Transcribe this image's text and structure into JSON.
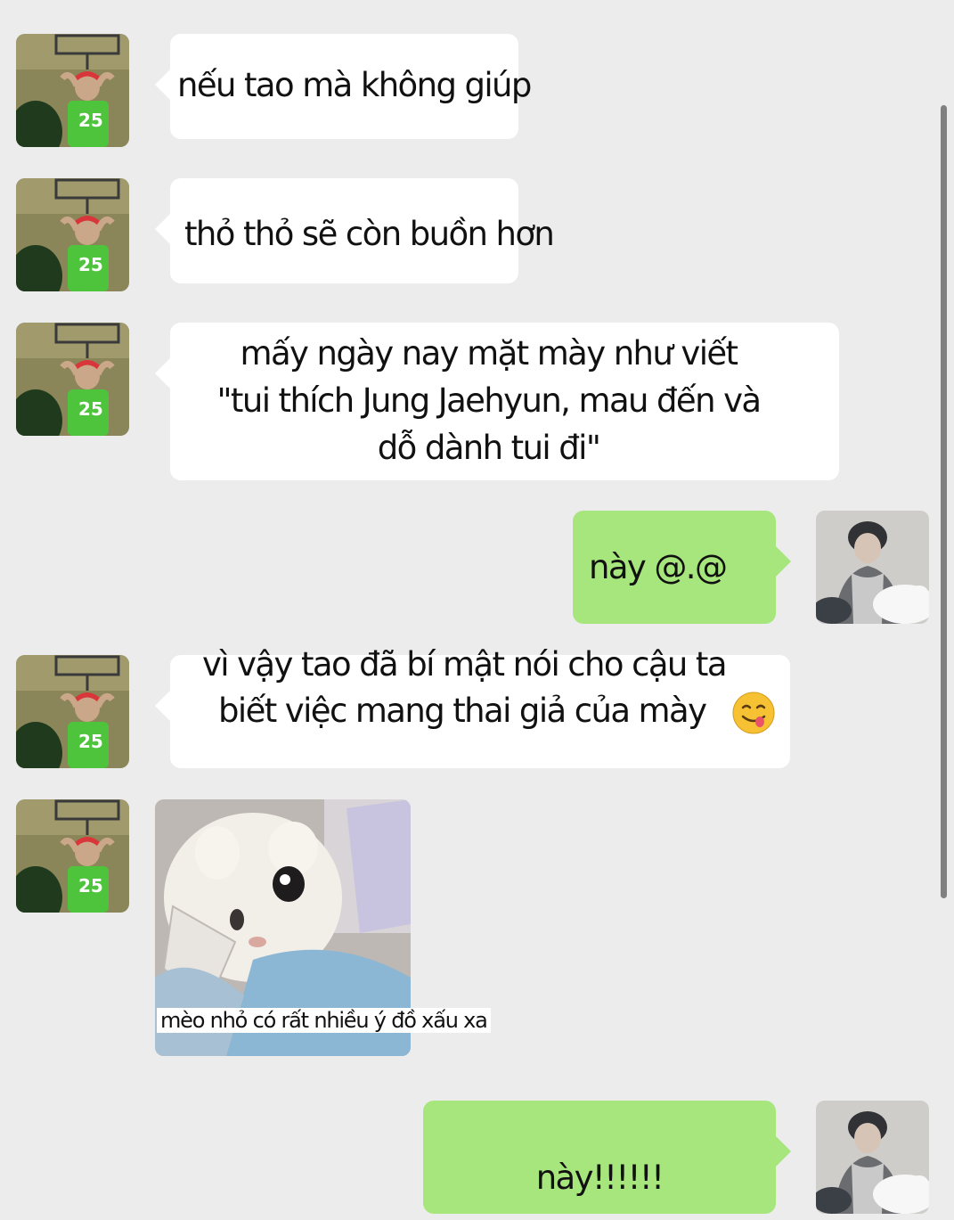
{
  "messages": [
    {
      "lines": [
        "nếu tao mà không giúp"
      ]
    },
    {
      "lines": [
        "thỏ thỏ sẽ còn buồn hơn"
      ]
    },
    {
      "lines": [
        "mấy ngày nay mặt mày như viết",
        "\"tui thích Jung Jaehyun, mau đến và",
        "dỗ dành tui đi\""
      ]
    },
    {
      "lines": [
        "này @.@"
      ]
    },
    {
      "lines": [
        "vì vậy tao đã bí mật nói cho cậu ta",
        "biết việc mang thai giả của mày"
      ]
    },
    {
      "caption": "mèo nhỏ có rất nhiều ý đồ xấu xa"
    },
    {
      "lines": [
        "này!!!!!!"
      ]
    }
  ],
  "icons": {
    "emoji": "smiling-face-savoring-food-icon",
    "incoming_avatar": "avatar-icon",
    "outgoing_avatar": "avatar-icon"
  },
  "colors": {
    "background": "#ececec",
    "incoming_bubble": "#ffffff",
    "outgoing_bubble": "#a6e67c"
  }
}
